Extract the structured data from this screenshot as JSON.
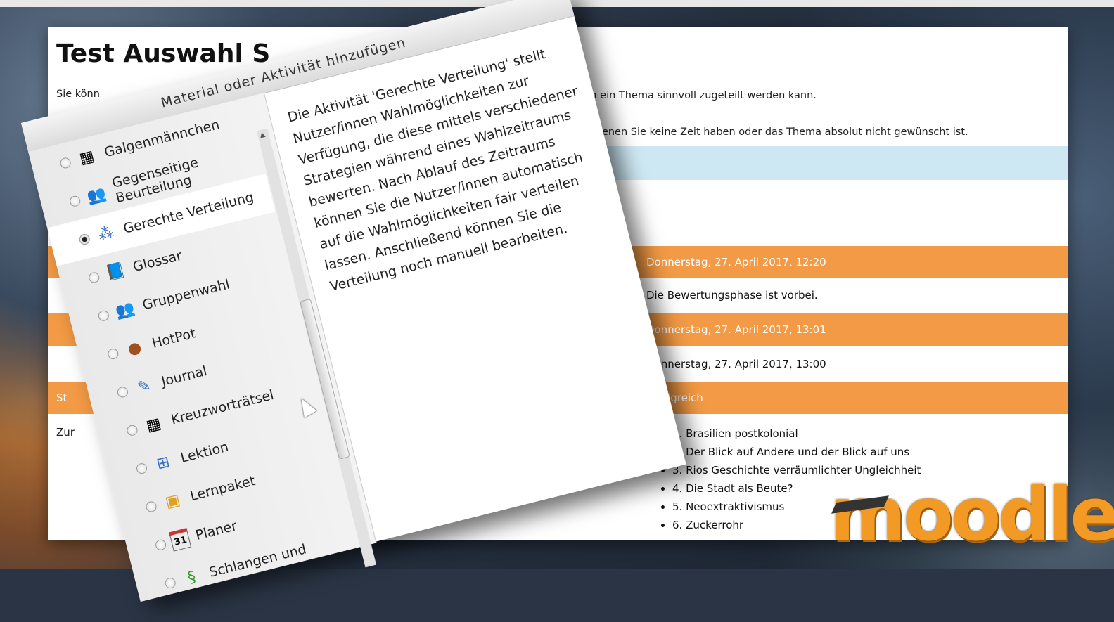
{
  "page": {
    "title": "Test Auswahl S",
    "intro_left_fragment": "Sie könn",
    "intro_line1": "dass Ihnen ein Thema sinnvoll zugeteilt werden kann.",
    "intro_line2": "lehnen an denen Sie keine Zeit haben oder das Thema absolut nicht gewünscht ist.",
    "rows": [
      {
        "style": "orange",
        "value": "Donnerstag, 27. April 2017, 12:20"
      },
      {
        "style": "white",
        "value": "Die Bewertungsphase ist vorbei."
      },
      {
        "style": "orange",
        "value": "Donnerstag, 27. April 2017, 13:01"
      },
      {
        "style": "white",
        "value": "Donnerstag, 27. April 2017, 13:00"
      },
      {
        "style": "orange",
        "value": "Erfolgreich"
      }
    ],
    "left_fragments": {
      "status": "St",
      "back": "Zur"
    },
    "topics": [
      "1. Brasilien postkolonial",
      "2. Der Blick auf Andere und der Blick auf uns",
      "3. Rios Geschichte verräumlichter Ungleichheit",
      "4. Die Stadt als Beute?",
      "5. Neoextraktivismus",
      "6. Zuckerrohr"
    ]
  },
  "dialog": {
    "title": "Material oder Aktivität hinzufügen",
    "items": [
      {
        "label": "Galgenmännchen",
        "icon": "puzzle-grid-icon",
        "selected": false
      },
      {
        "label": "Gegenseitige Beurteilung",
        "icon": "peer-review-icon",
        "selected": false
      },
      {
        "label": "Gerechte Verteilung",
        "icon": "distribution-icon",
        "selected": true
      },
      {
        "label": "Glossar",
        "icon": "glossary-icon",
        "selected": false
      },
      {
        "label": "Gruppenwahl",
        "icon": "group-icon",
        "selected": false
      },
      {
        "label": "HotPot",
        "icon": "hotpot-icon",
        "selected": false
      },
      {
        "label": "Journal",
        "icon": "journal-icon",
        "selected": false
      },
      {
        "label": "Kreuzworträtsel",
        "icon": "crossword-icon",
        "selected": false
      },
      {
        "label": "Lektion",
        "icon": "lesson-icon",
        "selected": false
      },
      {
        "label": "Lernpaket",
        "icon": "package-icon",
        "selected": false
      },
      {
        "label": "Planer",
        "icon": "calendar-icon",
        "selected": false
      },
      {
        "label": "Schlangen und",
        "icon": "snakes-icon",
        "selected": false
      }
    ],
    "description": "Die Aktivität 'Gerechte Verteilung' stellt Nutzer/innen Wahlmöglichkeiten zur Verfügung, die diese mittels verschiedener Strategien während eines Wahlzeitraums bewerten. Nach Ablauf des Zeitraums können Sie die Nutzer/innen automatisch auf die Wahlmöglichkeiten fair verteilen lassen. Anschließend können Sie die Verteilung noch manuell bearbeiten.",
    "calendar_icon_number": "31"
  },
  "logo": {
    "text": "moodle"
  },
  "colors": {
    "orange": "#f29a45",
    "blue_band": "#cde7f3",
    "logo_orange": "#f39a25"
  }
}
